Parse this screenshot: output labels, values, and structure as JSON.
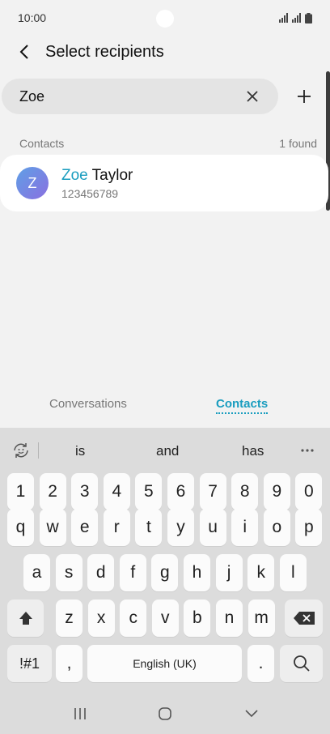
{
  "status_bar": {
    "time": "10:00"
  },
  "header": {
    "title": "Select recipients"
  },
  "search": {
    "value": "Zoe",
    "placeholder": ""
  },
  "section": {
    "label": "Contacts",
    "count": "1 found"
  },
  "contact": {
    "avatar_letter": "Z",
    "name_highlight": "Zoe",
    "name_rest": " Taylor",
    "number": "123456789"
  },
  "tabs": [
    {
      "label": "Conversations",
      "active": false
    },
    {
      "label": "Contacts",
      "active": true
    }
  ],
  "keyboard": {
    "suggestions": [
      "is",
      "and",
      "has"
    ],
    "row_numbers": [
      "1",
      "2",
      "3",
      "4",
      "5",
      "6",
      "7",
      "8",
      "9",
      "0"
    ],
    "row_1": [
      "q",
      "w",
      "e",
      "r",
      "t",
      "y",
      "u",
      "i",
      "o",
      "p"
    ],
    "row_2": [
      "a",
      "s",
      "d",
      "f",
      "g",
      "h",
      "j",
      "k",
      "l"
    ],
    "row_3": [
      "z",
      "x",
      "c",
      "v",
      "b",
      "n",
      "m"
    ],
    "symbols_label": "!#1",
    "comma_label": ",",
    "space_label": "English (UK)",
    "period_label": "."
  },
  "colors": {
    "accent": "#1a9dbf",
    "keyboard_bg": "#dcdcdc"
  }
}
